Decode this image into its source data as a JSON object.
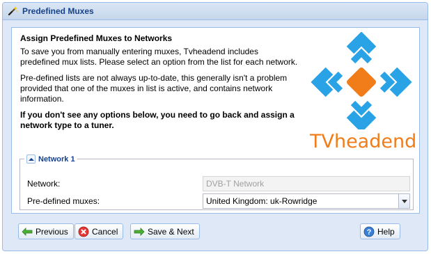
{
  "window": {
    "title": "Predefined Muxes"
  },
  "intro": {
    "heading": "Assign Predefined Muxes to Networks",
    "para1": "To save you from manually entering muxes, Tvheadend includes predefined mux lists. Please select an option from the list for each network.",
    "para2": "Pre-defined lists are not always up-to-date, this generally isn't a problem provided that one of the muxes in list is active, and contains network information.",
    "para3": "If you don't see any options below, you need to go back and assign a network type to a tuner."
  },
  "logo": {
    "text": "TVheadend",
    "colors": {
      "blue": "#2aa3e6",
      "orange": "#f07d1a"
    }
  },
  "network_panel": {
    "legend": "Network 1",
    "network_label": "Network:",
    "network_value": "DVB-T Network",
    "muxes_label": "Pre-defined muxes:",
    "muxes_value": "United Kingdom: uk-Rowridge"
  },
  "buttons": {
    "previous": "Previous",
    "cancel": "Cancel",
    "save_next": "Save & Next",
    "help": "Help"
  }
}
